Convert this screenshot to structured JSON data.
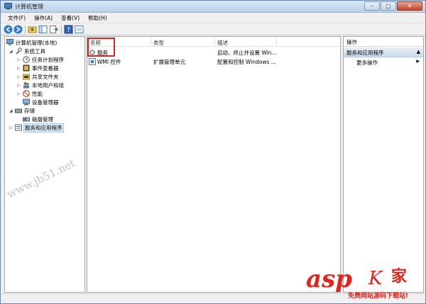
{
  "window": {
    "title": "计算机管理"
  },
  "menubar": {
    "items": [
      "文件(F)",
      "操作(A)",
      "查看(V)",
      "帮助(H)"
    ]
  },
  "tree": {
    "items": [
      {
        "label": "计算机管理(本地)",
        "icon": "computer-icon"
      },
      {
        "label": "系统工具",
        "icon": "tools-icon"
      },
      {
        "label": "任务计划程序",
        "icon": "clock-icon"
      },
      {
        "label": "事件查看器",
        "icon": "event-viewer-icon"
      },
      {
        "label": "共享文件夹",
        "icon": "shared-folder-icon"
      },
      {
        "label": "本地用户和组",
        "icon": "users-icon"
      },
      {
        "label": "性能",
        "icon": "performance-icon"
      },
      {
        "label": "设备管理器",
        "icon": "device-manager-icon"
      },
      {
        "label": "存储",
        "icon": "storage-icon"
      },
      {
        "label": "磁盘管理",
        "icon": "disk-icon"
      },
      {
        "label": "服务和应用程序",
        "icon": "services-apps-icon"
      }
    ]
  },
  "list": {
    "columns": [
      "名称",
      "类型",
      "描述"
    ],
    "rows": [
      {
        "name": "服务",
        "type": "",
        "desc": "启动、终止并设置 Win...",
        "icon": "services-icon"
      },
      {
        "name": "WMI 控件",
        "type": "扩展管理单元",
        "desc": "配置和控制 Windows ...",
        "icon": "wmi-icon"
      }
    ]
  },
  "actions": {
    "title": "操作",
    "section": "服务和应用程序",
    "more": "更多操作"
  },
  "watermark": {
    "diagonal": "www.jb51.net",
    "logo": "asp",
    "k": "K",
    "jia": "家",
    "sub": "免费网站源码下载站!"
  },
  "colors": {
    "accent": "#d9271c",
    "watermark": "#e6231b",
    "title_bar": "#c9dbee"
  }
}
